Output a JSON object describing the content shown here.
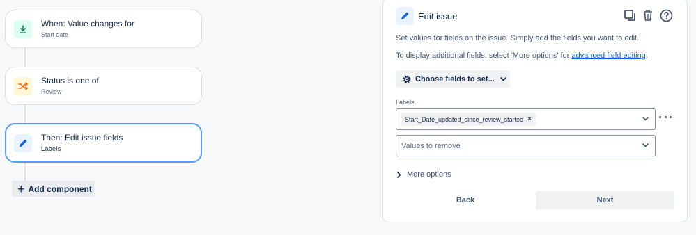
{
  "flow": {
    "trigger": {
      "title": "When: Value changes for",
      "subtitle": "Start date",
      "icon": "download-arrow-icon",
      "icon_bg": "#dcfff1",
      "icon_color": "#1f845a"
    },
    "condition": {
      "title": "Status is one of",
      "subtitle": "Review",
      "icon": "shuffle-icon",
      "icon_bg": "#fff7d6",
      "icon_color": "#e56910"
    },
    "action": {
      "title": "Then: Edit issue fields",
      "subtitle": "Labels",
      "icon": "pencil-icon",
      "icon_bg": "#e9f2ff",
      "icon_color": "#0c66e4"
    },
    "add_component_label": "Add component"
  },
  "panel": {
    "title": "Edit issue",
    "description_1": "Set values for fields on the issue. Simply add the fields you want to edit.",
    "description_2_prefix": "To display additional fields, select 'More options' for ",
    "description_2_link": "advanced field editing",
    "description_2_suffix": ".",
    "choose_fields_label": "Choose fields to set...",
    "labels_field": {
      "label": "Labels",
      "selected_tags": [
        "Start_Date_updated_since_review_started"
      ],
      "remove_icon": "×"
    },
    "values_to_remove_placeholder": "Values to remove",
    "more_options_label": "More options",
    "back_label": "Back",
    "next_label": "Next",
    "header_actions": [
      "copy-icon",
      "trash-icon",
      "help-icon"
    ],
    "accent_color": "#0c66e4"
  }
}
